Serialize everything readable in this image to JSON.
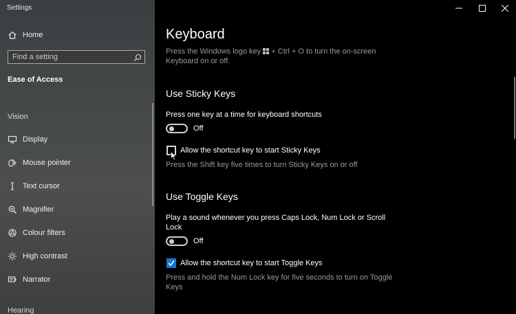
{
  "window": {
    "title": "Settings"
  },
  "sidebar": {
    "home_label": "Home",
    "search_placeholder": "Find a setting",
    "category": "Ease of Access",
    "vision_heading": "Vision",
    "items": [
      {
        "label": "Display",
        "icon": "display-icon"
      },
      {
        "label": "Mouse pointer",
        "icon": "mouse-pointer-icon"
      },
      {
        "label": "Text cursor",
        "icon": "text-cursor-icon"
      },
      {
        "label": "Magnifier",
        "icon": "magnifier-icon"
      },
      {
        "label": "Colour filters",
        "icon": "colour-filters-icon"
      },
      {
        "label": "High contrast",
        "icon": "high-contrast-icon"
      },
      {
        "label": "Narrator",
        "icon": "narrator-icon"
      }
    ],
    "hearing_heading": "Hearing"
  },
  "main": {
    "title": "Keyboard",
    "intro_line1": "Press the Windows logo key ",
    "intro_line1b": " + Ctrl + O to turn the on-screen",
    "intro_line2": "Keyboard on or off.",
    "sticky": {
      "heading": "Use Sticky Keys",
      "toggle_label": "Press one key at a time for keyboard shortcuts",
      "toggle_state": "Off",
      "checkbox_label": "Allow the shortcut key to start Sticky Keys",
      "checkbox_checked": false,
      "hint": "Press the Shift key five times to turn Sticky Keys on or off"
    },
    "togglekeys": {
      "heading": "Use Toggle Keys",
      "toggle_label_line1": "Play a sound whenever you press Caps Lock, Num Lock or Scroll",
      "toggle_label_line2": "Lock",
      "toggle_state": "Off",
      "checkbox_label": "Allow the shortcut key to start Toggle Keys",
      "checkbox_checked": true,
      "hint_line1": "Press and hold the Num Lock key for five seconds to turn on Toggle",
      "hint_line2": "Keys"
    }
  },
  "colors": {
    "accent": "#0f78d4",
    "background": "#000000",
    "sidebar": "#46494a"
  }
}
